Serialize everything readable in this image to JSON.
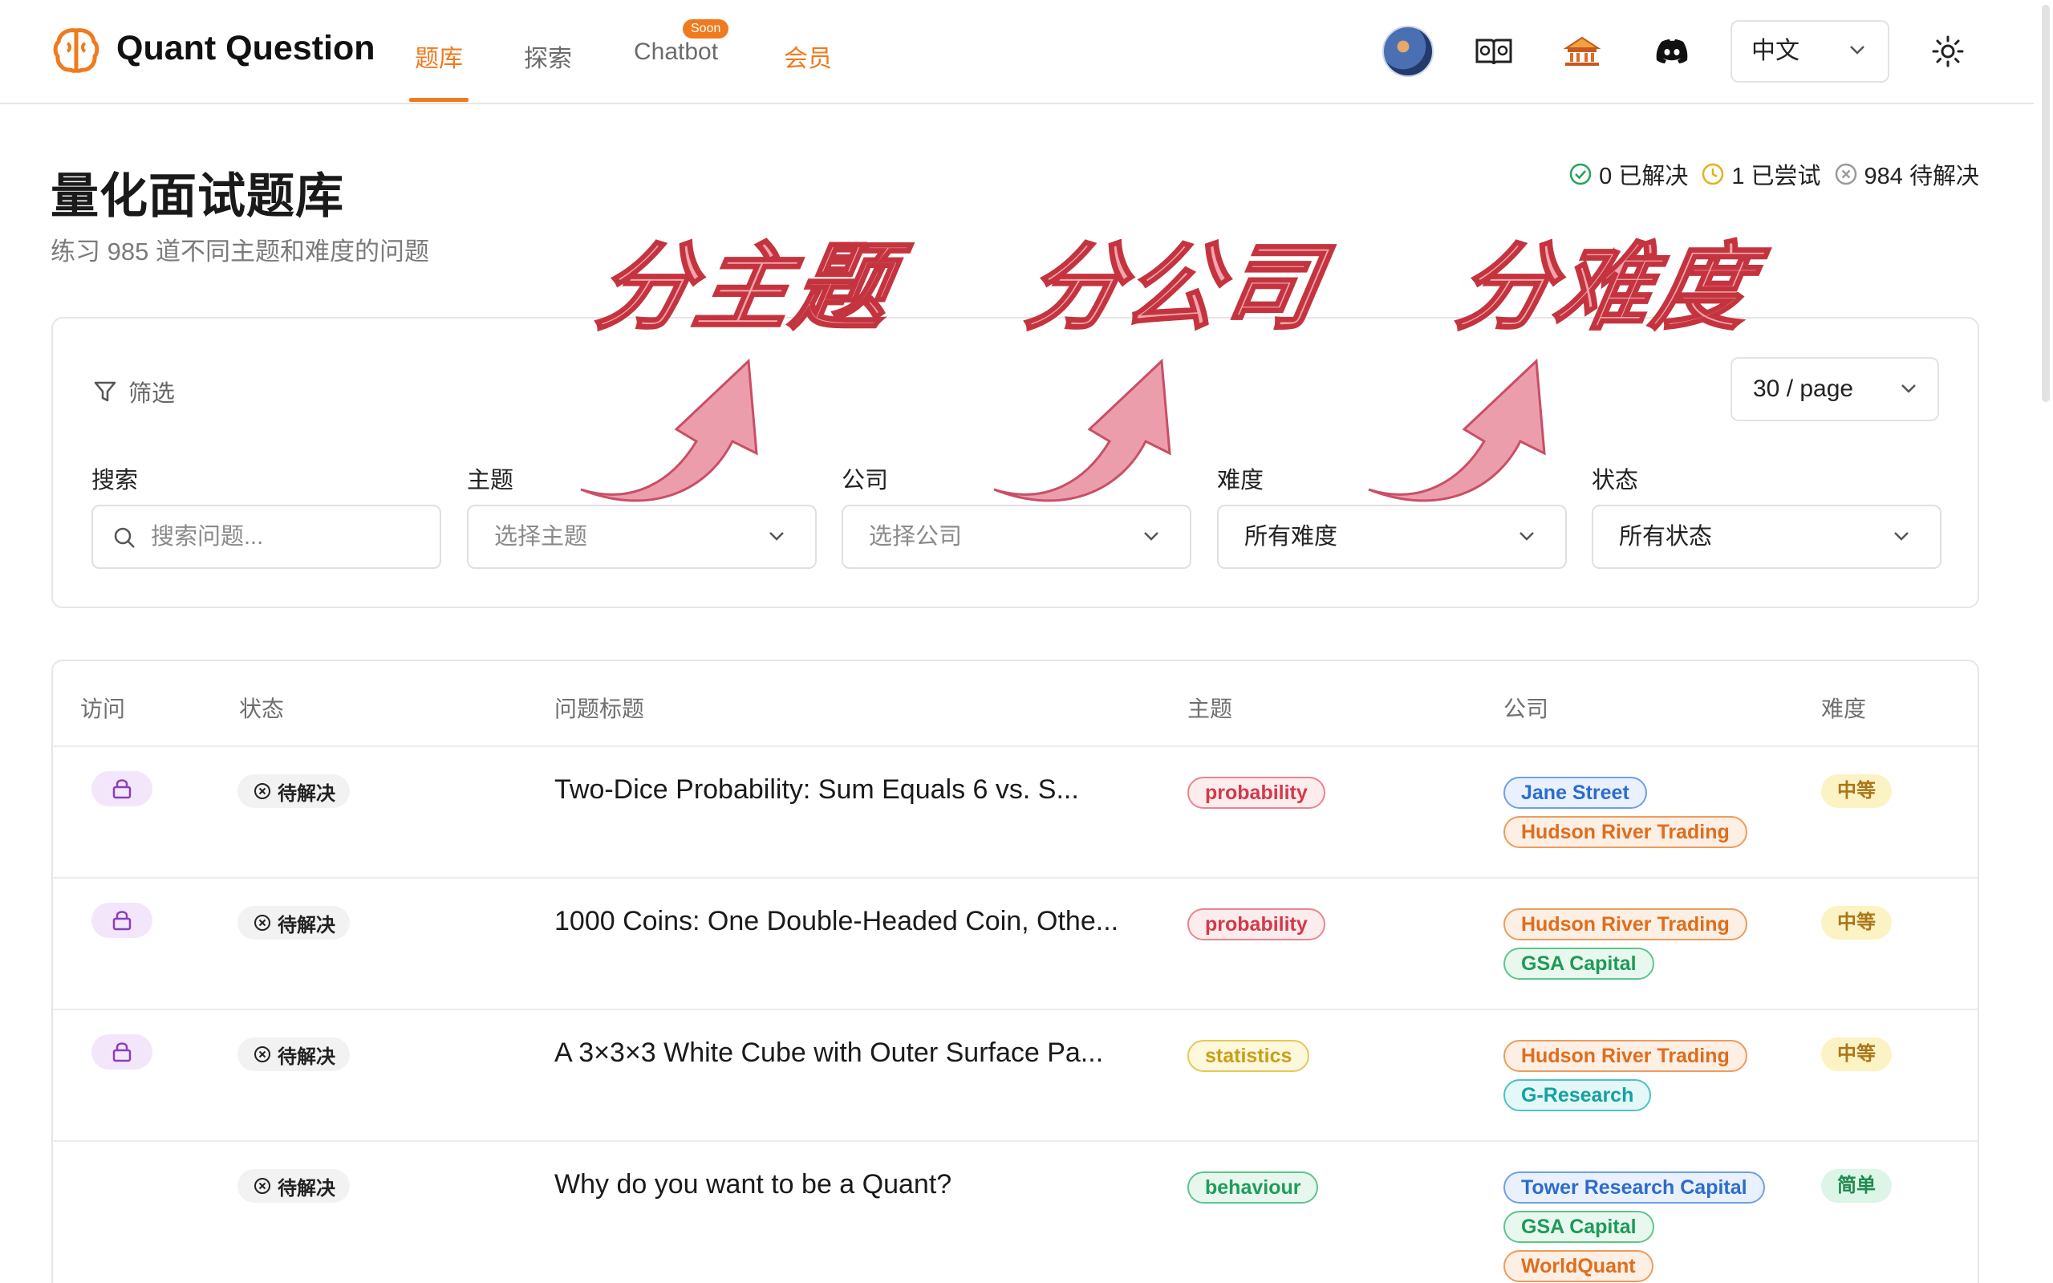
{
  "brand": {
    "name": "Quant Question",
    "accent": "#f07a1e"
  },
  "nav": {
    "items": [
      {
        "label": "题库",
        "active": true
      },
      {
        "label": "探索"
      },
      {
        "label": "Chatbot",
        "badge": "Soon"
      },
      {
        "label": "会员",
        "highlight": true
      }
    ]
  },
  "header_icons": [
    "avatar",
    "book-icon",
    "temple-icon",
    "discord-icon",
    "sun-icon"
  ],
  "language": {
    "selected": "中文"
  },
  "page": {
    "title": "量化面试题库",
    "subtitle": "练习 985 道不同主题和难度的问题"
  },
  "stats": {
    "solved": "0 已解决",
    "attempted": "1 已尝试",
    "unsolved": "984 待解决"
  },
  "annotations": {
    "topic": "分主题",
    "company": "分公司",
    "difficulty": "分难度"
  },
  "filters": {
    "heading": "筛选",
    "page_size": "30 / page",
    "search": {
      "label": "搜索",
      "placeholder": "搜索问题..."
    },
    "topic": {
      "label": "主题",
      "placeholder": "选择主题"
    },
    "company": {
      "label": "公司",
      "placeholder": "选择公司"
    },
    "difficulty": {
      "label": "难度",
      "value": "所有难度"
    },
    "status": {
      "label": "状态",
      "value": "所有状态"
    }
  },
  "table": {
    "headers": {
      "access": "访问",
      "status": "状态",
      "title": "问题标题",
      "topic": "主题",
      "company": "公司",
      "difficulty": "难度"
    },
    "rows": [
      {
        "locked": true,
        "status": "待解决",
        "title": "Two-Dice Probability: Sum Equals 6 vs. S...",
        "topic": "probability",
        "companies": [
          "Jane Street",
          "Hudson River Trading"
        ],
        "difficulty": "中等"
      },
      {
        "locked": true,
        "status": "待解决",
        "title": "1000 Coins: One Double-Headed Coin, Othe...",
        "topic": "probability",
        "companies": [
          "Hudson River Trading",
          "GSA Capital"
        ],
        "difficulty": "中等"
      },
      {
        "locked": true,
        "status": "待解决",
        "title": "A 3×3×3 White Cube with Outer Surface Pa...",
        "topic": "statistics",
        "companies": [
          "Hudson River Trading",
          "G-Research"
        ],
        "difficulty": "中等"
      },
      {
        "locked": false,
        "status": "待解决",
        "title": "Why do you want to be a Quant?",
        "topic": "behaviour",
        "companies": [
          "Tower Research Capital",
          "GSA Capital",
          "WorldQuant"
        ],
        "difficulty": "简单"
      }
    ]
  }
}
